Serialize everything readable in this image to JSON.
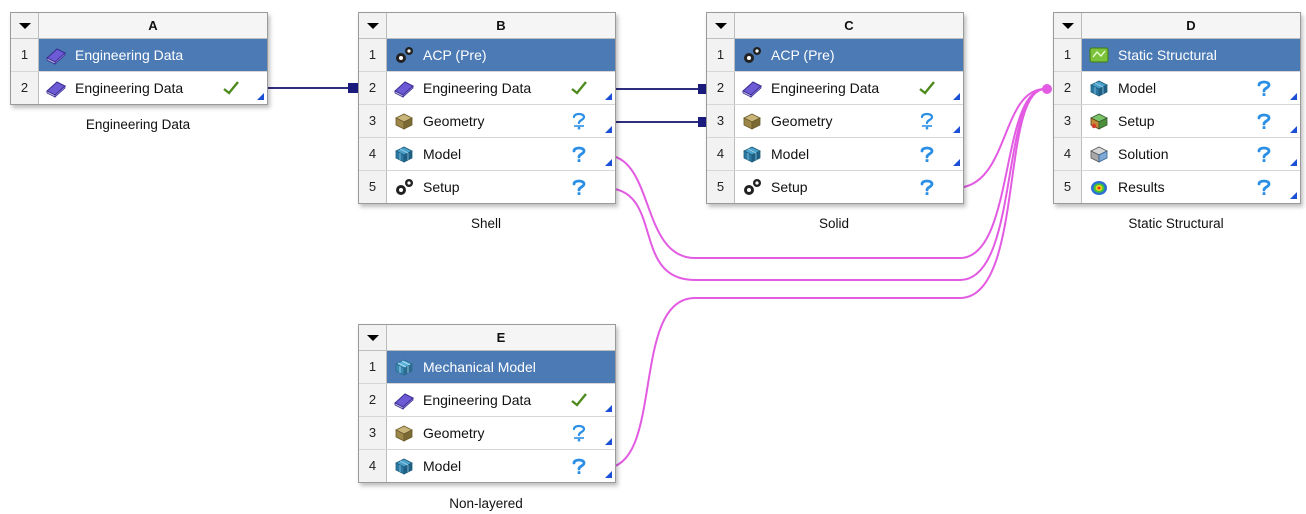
{
  "systems": {
    "A": {
      "letter": "A",
      "caption": "Engineering Data",
      "rows": [
        {
          "num": "1",
          "label": "Engineering Data"
        },
        {
          "num": "2",
          "label": "Engineering Data"
        }
      ]
    },
    "B": {
      "letter": "B",
      "caption": "Shell",
      "rows": [
        {
          "num": "1",
          "label": "ACP (Pre)"
        },
        {
          "num": "2",
          "label": "Engineering Data"
        },
        {
          "num": "3",
          "label": "Geometry"
        },
        {
          "num": "4",
          "label": "Model"
        },
        {
          "num": "5",
          "label": "Setup"
        }
      ]
    },
    "C": {
      "letter": "C",
      "caption": "Solid",
      "rows": [
        {
          "num": "1",
          "label": "ACP (Pre)"
        },
        {
          "num": "2",
          "label": "Engineering Data"
        },
        {
          "num": "3",
          "label": "Geometry"
        },
        {
          "num": "4",
          "label": "Model"
        },
        {
          "num": "5",
          "label": "Setup"
        }
      ]
    },
    "D": {
      "letter": "D",
      "caption": "Static Structural",
      "rows": [
        {
          "num": "1",
          "label": "Static Structural"
        },
        {
          "num": "2",
          "label": "Model"
        },
        {
          "num": "3",
          "label": "Setup"
        },
        {
          "num": "4",
          "label": "Solution"
        },
        {
          "num": "5",
          "label": "Results"
        }
      ]
    },
    "E": {
      "letter": "E",
      "caption": "Non-layered",
      "rows": [
        {
          "num": "1",
          "label": "Mechanical Model"
        },
        {
          "num": "2",
          "label": "Engineering Data"
        },
        {
          "num": "3",
          "label": "Geometry"
        },
        {
          "num": "4",
          "label": "Model"
        }
      ]
    }
  },
  "colors": {
    "title_bg": "#4b7ab4",
    "data_link": "#2e2e7e",
    "model_link": "#e25be2",
    "check": "#4e8a1e",
    "attention": "#2c8fe6"
  }
}
